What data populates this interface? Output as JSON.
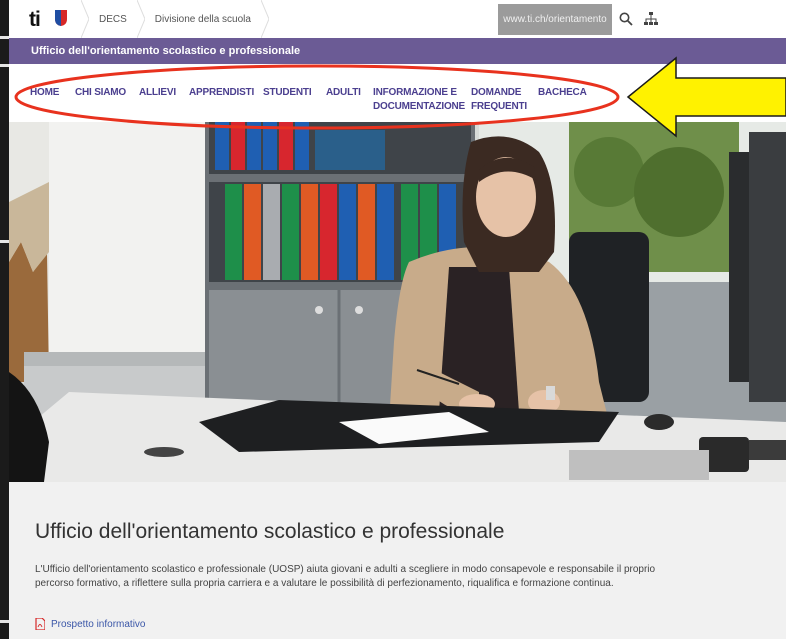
{
  "topbar": {
    "logo_text": "ti",
    "crumbs": [
      "DECS",
      "Divisione della scuola"
    ],
    "url": "www.ti.ch/orientamento",
    "icons": [
      "search-icon",
      "sitemap-icon"
    ]
  },
  "section_title": "Ufficio dell'orientamento scolastico e professionale",
  "nav": {
    "items": [
      {
        "label": "HOME"
      },
      {
        "label": "CHI SIAMO"
      },
      {
        "label": "ALLIEVI"
      },
      {
        "label": "APPRENDISTI"
      },
      {
        "label": "STUDENTI"
      },
      {
        "label": "ADULTI"
      },
      {
        "label_line1": "INFORMAZIONE E",
        "label_line2": "DOCUMENTAZIONE"
      },
      {
        "label_line1": "DOMANDE",
        "label_line2": "FREQUENTI"
      },
      {
        "label": "BACHECA"
      }
    ]
  },
  "content": {
    "heading": "Ufficio dell'orientamento scolastico e professionale",
    "paragraph": "L'Ufficio dell'orientamento scolastico e professionale (UOSP) aiuta giovani e adulti a scegliere in modo consapevole e responsabile il proprio percorso formativo, a riflettere sulla propria carriera e a valutare le possibilità di perfezionamento, riqualifica e formazione continua.",
    "link_label": "Prospetto informativo"
  },
  "colors": {
    "purple": "#6b5b95",
    "nav_text": "#4b3f8f",
    "annotation_red": "#e8321e",
    "annotation_yellow": "#fff200"
  }
}
